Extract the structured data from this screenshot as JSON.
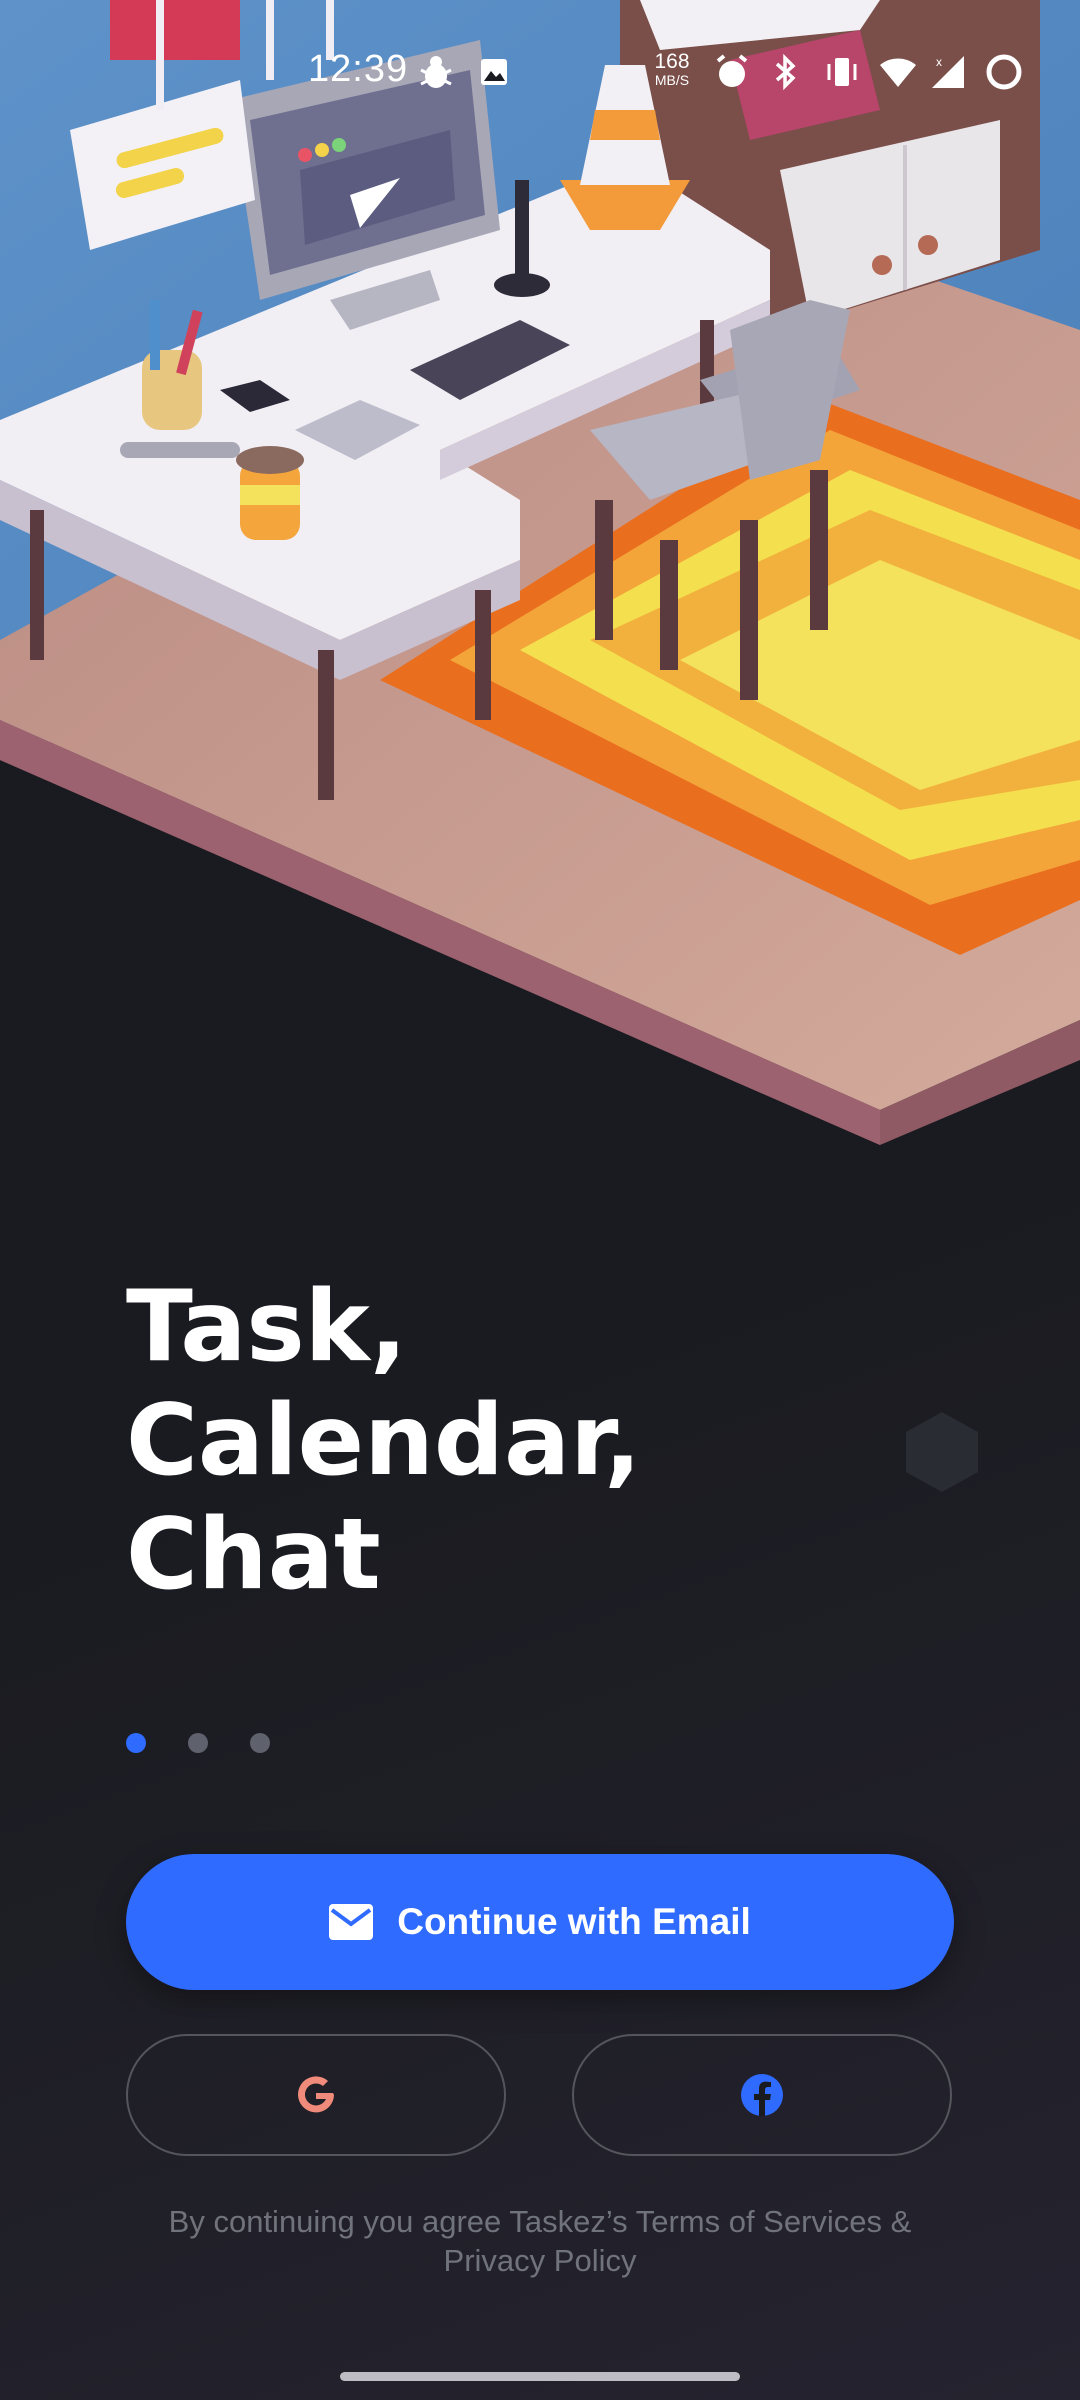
{
  "status_bar": {
    "time": "12:39",
    "net_speed_value": "168",
    "net_speed_unit": "MB/S",
    "icons": [
      "bug-icon",
      "image-icon",
      "alarm-icon",
      "bluetooth-icon",
      "vibrate-icon",
      "wifi-icon",
      "cellular-signal-icon",
      "battery-ring-icon"
    ]
  },
  "hero": {
    "illustration": "isometric-desk-room-illustration"
  },
  "title": {
    "line1": "Task,",
    "line2": "Calendar,",
    "line3": "Chat"
  },
  "pager": {
    "total": 3,
    "active_index": 0
  },
  "actions": {
    "email_label": "Continue with Email",
    "google_icon": "google-icon",
    "facebook_icon": "facebook-icon"
  },
  "terms": {
    "line1": "By continuing you agree Taskez’s Terms of Services &",
    "line2": "Privacy Policy"
  },
  "colors": {
    "background": "#1a1b20",
    "accent": "#2f6bff",
    "title": "#ffffff",
    "muted_text": "#70727c",
    "dot_inactive": "#5f616d",
    "google_red": "#f08a7a",
    "facebook_blue": "#2f6bff"
  }
}
